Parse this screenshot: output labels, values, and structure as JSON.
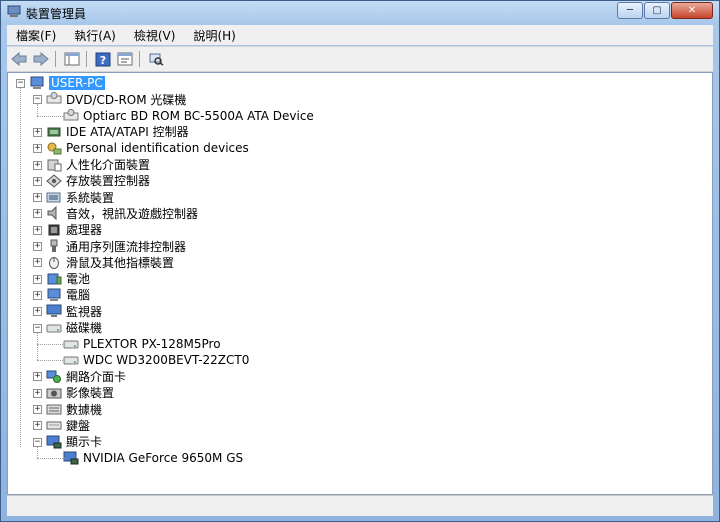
{
  "window": {
    "title": "裝置管理員"
  },
  "menu": [
    "檔案(F)",
    "執行(A)",
    "檢視(V)",
    "說明(H)"
  ],
  "tree": {
    "root": "USER-PC",
    "categories": [
      {
        "label": "DVD/CD-ROM 光碟機",
        "icon": "dvd-icon",
        "expanded": true,
        "children": [
          {
            "label": "Optiarc BD ROM BC-5500A ATA Device",
            "icon": "dvd-icon"
          }
        ]
      },
      {
        "label": "IDE ATA/ATAPI 控制器",
        "icon": "ide-controller-icon",
        "expanded": false
      },
      {
        "label": "Personal identification devices",
        "icon": "fingerprint-icon",
        "expanded": false
      },
      {
        "label": "人性化介面裝置",
        "icon": "hid-icon",
        "expanded": false
      },
      {
        "label": "存放裝置控制器",
        "icon": "storage-controller-icon",
        "expanded": false
      },
      {
        "label": "系統裝置",
        "icon": "system-device-icon",
        "expanded": false
      },
      {
        "label": "音效，視訊及遊戲控制器",
        "icon": "speaker-icon",
        "expanded": false
      },
      {
        "label": "處理器",
        "icon": "processor-icon",
        "expanded": false
      },
      {
        "label": "通用序列匯流排控制器",
        "icon": "usb-icon",
        "expanded": false
      },
      {
        "label": "滑鼠及其他指標裝置",
        "icon": "mouse-icon",
        "expanded": false
      },
      {
        "label": "電池",
        "icon": "battery-icon",
        "expanded": false
      },
      {
        "label": "電腦",
        "icon": "computer-icon",
        "expanded": false
      },
      {
        "label": "監視器",
        "icon": "monitor-icon",
        "expanded": false
      },
      {
        "label": "磁碟機",
        "icon": "disk-drive-icon",
        "expanded": true,
        "children": [
          {
            "label": "PLEXTOR PX-128M5Pro",
            "icon": "disk-drive-icon"
          },
          {
            "label": "WDC WD3200BEVT-22ZCT0",
            "icon": "disk-drive-icon"
          }
        ]
      },
      {
        "label": "網路介面卡",
        "icon": "network-adapter-icon",
        "expanded": false
      },
      {
        "label": "影像裝置",
        "icon": "camera-icon",
        "expanded": false
      },
      {
        "label": "數據機",
        "icon": "modem-icon",
        "expanded": false
      },
      {
        "label": "鍵盤",
        "icon": "keyboard-icon",
        "expanded": false
      },
      {
        "label": "顯示卡",
        "icon": "display-adapter-icon",
        "expanded": true,
        "children": [
          {
            "label": "NVIDIA GeForce 9650M GS",
            "icon": "display-adapter-icon"
          }
        ]
      }
    ]
  },
  "colors": {
    "selection": "#3399ff",
    "window_frame": "#a9c8ea"
  }
}
